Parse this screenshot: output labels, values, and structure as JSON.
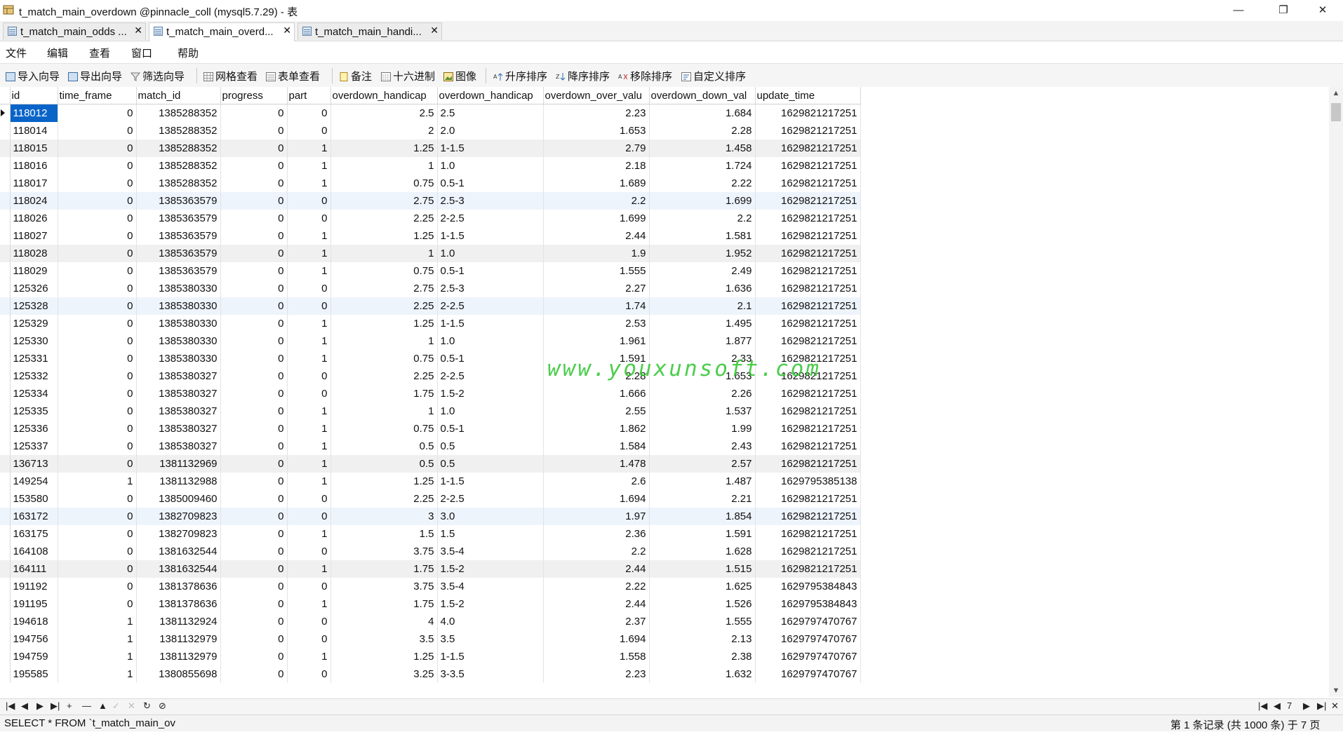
{
  "window": {
    "title": "t_match_main_overdown @pinnacle_coll (mysql5.7.29) - 表",
    "minimize": "—",
    "maximize": "❐",
    "close": "✕"
  },
  "tabs": [
    {
      "label": "t_match_main_odds ...",
      "close": "✕"
    },
    {
      "label": "t_match_main_overd...",
      "close": "✕"
    },
    {
      "label": "t_match_main_handi...",
      "close": "✕"
    }
  ],
  "menu": [
    "文件",
    "编辑",
    "查看",
    "窗口",
    "帮助"
  ],
  "toolbar": {
    "import": "导入向导",
    "export": "导出向导",
    "filter": "筛选向导",
    "grid_view": "网格查看",
    "form_view": "表单查看",
    "memo": "备注",
    "hex": "十六进制",
    "image": "图像",
    "sort_asc": "升序排序",
    "sort_desc": "降序排序",
    "remove_sort": "移除排序",
    "custom_sort": "自定义排序"
  },
  "columns": [
    "id",
    "time_frame",
    "match_id",
    "progress",
    "part",
    "overdown_handicap",
    "overdown_handicap",
    "overdown_over_valu",
    "overdown_down_val",
    "update_time"
  ],
  "rows": [
    [
      "118012",
      "0",
      "1385288352",
      "0",
      "0",
      "2.5",
      "2.5",
      "2.23",
      "1.684",
      "1629821217251"
    ],
    [
      "118014",
      "0",
      "1385288352",
      "0",
      "0",
      "2",
      "2.0",
      "1.653",
      "2.28",
      "1629821217251"
    ],
    [
      "118015",
      "0",
      "1385288352",
      "0",
      "1",
      "1.25",
      "1-1.5",
      "2.79",
      "1.458",
      "1629821217251"
    ],
    [
      "118016",
      "0",
      "1385288352",
      "0",
      "1",
      "1",
      "1.0",
      "2.18",
      "1.724",
      "1629821217251"
    ],
    [
      "118017",
      "0",
      "1385288352",
      "0",
      "1",
      "0.75",
      "0.5-1",
      "1.689",
      "2.22",
      "1629821217251"
    ],
    [
      "118024",
      "0",
      "1385363579",
      "0",
      "0",
      "2.75",
      "2.5-3",
      "2.2",
      "1.699",
      "1629821217251"
    ],
    [
      "118026",
      "0",
      "1385363579",
      "0",
      "0",
      "2.25",
      "2-2.5",
      "1.699",
      "2.2",
      "1629821217251"
    ],
    [
      "118027",
      "0",
      "1385363579",
      "0",
      "1",
      "1.25",
      "1-1.5",
      "2.44",
      "1.581",
      "1629821217251"
    ],
    [
      "118028",
      "0",
      "1385363579",
      "0",
      "1",
      "1",
      "1.0",
      "1.9",
      "1.952",
      "1629821217251"
    ],
    [
      "118029",
      "0",
      "1385363579",
      "0",
      "1",
      "0.75",
      "0.5-1",
      "1.555",
      "2.49",
      "1629821217251"
    ],
    [
      "125326",
      "0",
      "1385380330",
      "0",
      "0",
      "2.75",
      "2.5-3",
      "2.27",
      "1.636",
      "1629821217251"
    ],
    [
      "125328",
      "0",
      "1385380330",
      "0",
      "0",
      "2.25",
      "2-2.5",
      "1.74",
      "2.1",
      "1629821217251"
    ],
    [
      "125329",
      "0",
      "1385380330",
      "0",
      "1",
      "1.25",
      "1-1.5",
      "2.53",
      "1.495",
      "1629821217251"
    ],
    [
      "125330",
      "0",
      "1385380330",
      "0",
      "1",
      "1",
      "1.0",
      "1.961",
      "1.877",
      "1629821217251"
    ],
    [
      "125331",
      "0",
      "1385380330",
      "0",
      "1",
      "0.75",
      "0.5-1",
      "1.591",
      "2.33",
      "1629821217251"
    ],
    [
      "125332",
      "0",
      "1385380327",
      "0",
      "0",
      "2.25",
      "2-2.5",
      "2.28",
      "1.653",
      "1629821217251"
    ],
    [
      "125334",
      "0",
      "1385380327",
      "0",
      "0",
      "1.75",
      "1.5-2",
      "1.666",
      "2.26",
      "1629821217251"
    ],
    [
      "125335",
      "0",
      "1385380327",
      "0",
      "1",
      "1",
      "1.0",
      "2.55",
      "1.537",
      "1629821217251"
    ],
    [
      "125336",
      "0",
      "1385380327",
      "0",
      "1",
      "0.75",
      "0.5-1",
      "1.862",
      "1.99",
      "1629821217251"
    ],
    [
      "125337",
      "0",
      "1385380327",
      "0",
      "1",
      "0.5",
      "0.5",
      "1.584",
      "2.43",
      "1629821217251"
    ],
    [
      "136713",
      "0",
      "1381132969",
      "0",
      "1",
      "0.5",
      "0.5",
      "1.478",
      "2.57",
      "1629821217251"
    ],
    [
      "149254",
      "1",
      "1381132988",
      "0",
      "1",
      "1.25",
      "1-1.5",
      "2.6",
      "1.487",
      "1629795385138"
    ],
    [
      "153580",
      "0",
      "1385009460",
      "0",
      "0",
      "2.25",
      "2-2.5",
      "1.694",
      "2.21",
      "1629821217251"
    ],
    [
      "163172",
      "0",
      "1382709823",
      "0",
      "0",
      "3",
      "3.0",
      "1.97",
      "1.854",
      "1629821217251"
    ],
    [
      "163175",
      "0",
      "1382709823",
      "0",
      "1",
      "1.5",
      "1.5",
      "2.36",
      "1.591",
      "1629821217251"
    ],
    [
      "164108",
      "0",
      "1381632544",
      "0",
      "0",
      "3.75",
      "3.5-4",
      "2.2",
      "1.628",
      "1629821217251"
    ],
    [
      "164111",
      "0",
      "1381632544",
      "0",
      "1",
      "1.75",
      "1.5-2",
      "2.44",
      "1.515",
      "1629821217251"
    ],
    [
      "191192",
      "0",
      "1381378636",
      "0",
      "0",
      "3.75",
      "3.5-4",
      "2.22",
      "1.625",
      "1629795384843"
    ],
    [
      "191195",
      "0",
      "1381378636",
      "0",
      "1",
      "1.75",
      "1.5-2",
      "2.44",
      "1.526",
      "1629795384843"
    ],
    [
      "194618",
      "1",
      "1381132924",
      "0",
      "0",
      "4",
      "4.0",
      "2.37",
      "1.555",
      "1629797470767"
    ],
    [
      "194756",
      "1",
      "1381132979",
      "0",
      "0",
      "3.5",
      "3.5",
      "1.694",
      "2.13",
      "1629797470767"
    ],
    [
      "194759",
      "1",
      "1381132979",
      "0",
      "1",
      "1.25",
      "1-1.5",
      "1.558",
      "2.38",
      "1629797470767"
    ],
    [
      "195585",
      "1",
      "1380855698",
      "0",
      "0",
      "3.25",
      "3-3.5",
      "2.23",
      "1.632",
      "1629797470767"
    ]
  ],
  "selected_row_index": 0,
  "highlight_rows": [
    5,
    11,
    23
  ],
  "alt_rows": [
    2,
    8,
    20,
    26
  ],
  "watermark": "www.youxunsoft.com",
  "navbar": {
    "left_icons": [
      "|◀",
      "◀",
      "▶",
      "▶|",
      "+",
      "—",
      "▲",
      "✓",
      "✕",
      "↻",
      "⊘"
    ],
    "page_value": "7",
    "right_icons": [
      "|◀",
      "◀",
      "▶",
      "▶|",
      "✕"
    ]
  },
  "status": {
    "sql": "SELECT * FROM `t_match_main_ov",
    "records": "第 1 条记录 (共 1000 条) 于 7 页"
  }
}
